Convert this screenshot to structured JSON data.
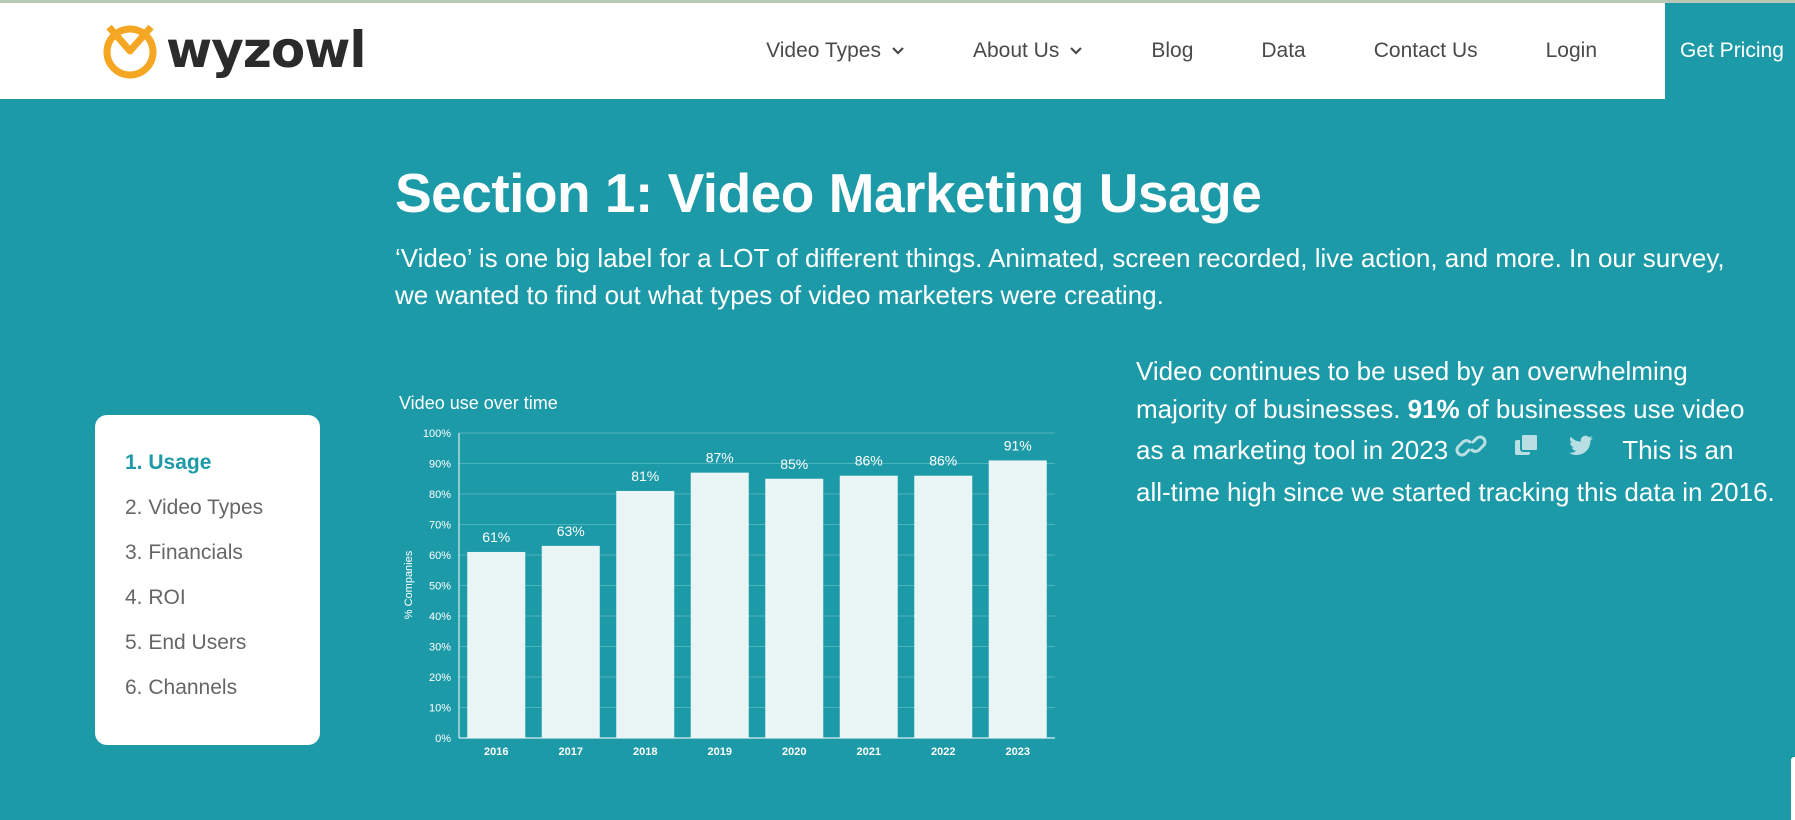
{
  "header": {
    "logo_text": "wyzowl",
    "nav": [
      {
        "label": "Video Types",
        "dropdown": true
      },
      {
        "label": "About Us",
        "dropdown": true
      },
      {
        "label": "Blog",
        "dropdown": false
      },
      {
        "label": "Data",
        "dropdown": false
      },
      {
        "label": "Contact Us",
        "dropdown": false
      },
      {
        "label": "Login",
        "dropdown": false
      }
    ],
    "cta": "Get Pricing"
  },
  "section": {
    "title": "Section 1: Video Marketing Usage",
    "intro_line1": "‘Video’ is one big label for a LOT of different things. Animated, screen recorded, live action, and more. In our survey,",
    "intro_line2": "we wanted to find out what types of video marketers were creating."
  },
  "sidebar": {
    "items": [
      {
        "label": "1. Usage",
        "active": true
      },
      {
        "label": "2. Video Types",
        "active": false
      },
      {
        "label": "3. Financials",
        "active": false
      },
      {
        "label": "4. ROI",
        "active": false
      },
      {
        "label": "5. End Users",
        "active": false
      },
      {
        "label": "6. Channels",
        "active": false
      }
    ]
  },
  "stat": {
    "line1": "Video continues to be used by an overwhelming",
    "line2_pre": "majority of businesses. ",
    "line2_bold": "91%",
    "line2_post": " of businesses use video",
    "line3_pre": "as a marketing tool in 2023",
    "line3_post": "This is an",
    "line4": "all-time high since we started tracking this data in 2016."
  },
  "icons": {
    "link": "link-icon",
    "copy": "copy-icon",
    "twitter": "twitter-icon",
    "chevron": "chevron-down-icon",
    "logo_mark": "clock-logo-icon"
  },
  "colors": {
    "teal": "#1d9aa8",
    "logo_orange": "#f5a623",
    "bar_fill": "#eaf6f6",
    "text_dark": "#4a4a4a"
  },
  "chart_data": {
    "type": "bar",
    "title": "Video use over time",
    "xlabel": "",
    "ylabel": "% Companies",
    "categories": [
      "2016",
      "2017",
      "2018",
      "2019",
      "2020",
      "2021",
      "2022",
      "2023"
    ],
    "values": [
      61,
      63,
      81,
      87,
      85,
      86,
      86,
      91
    ],
    "data_labels": [
      "61%",
      "63%",
      "81%",
      "87%",
      "85%",
      "86%",
      "86%",
      "91%"
    ],
    "ylim": [
      0,
      100
    ],
    "yticks": [
      "0%",
      "10%",
      "20%",
      "30%",
      "40%",
      "50%",
      "60%",
      "70%",
      "80%",
      "90%",
      "100%"
    ],
    "grid": true,
    "legend": false
  }
}
